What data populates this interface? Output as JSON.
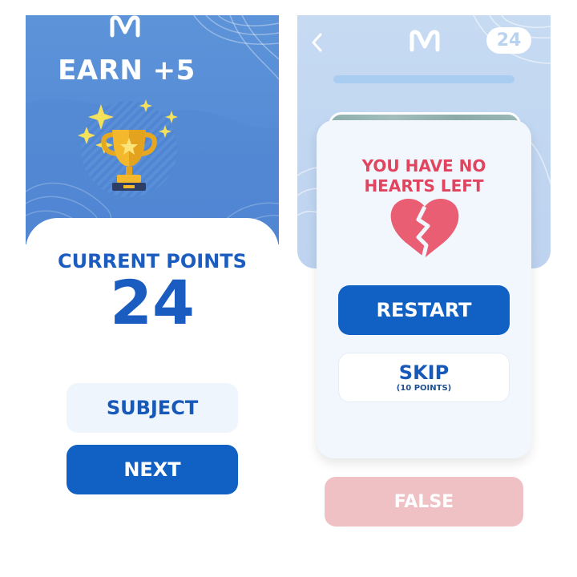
{
  "left": {
    "logo": "M",
    "earn_label": "EARN +5",
    "current_points_label": "CURRENT POINTS",
    "current_points_value": "24",
    "subject_button": "SUBJECT",
    "next_button": "NEXT"
  },
  "right": {
    "logo": "M",
    "points_badge": "24",
    "no_hearts_line1": "YOU HAVE NO",
    "no_hearts_line2": "HEARTS LEFT",
    "restart_button": "RESTART",
    "skip_button": "SKIP",
    "skip_cost": "(10 POINTS)",
    "false_button": "FALSE"
  },
  "colors": {
    "primary_blue": "#1160c4",
    "header_blue": "#5d93d8",
    "heart_red": "#e0445e",
    "false_pink": "#efc1c5"
  },
  "icons": [
    "logo-icon",
    "trophy-icon",
    "sparkle-icon",
    "back-chevron-icon",
    "broken-heart-icon"
  ]
}
